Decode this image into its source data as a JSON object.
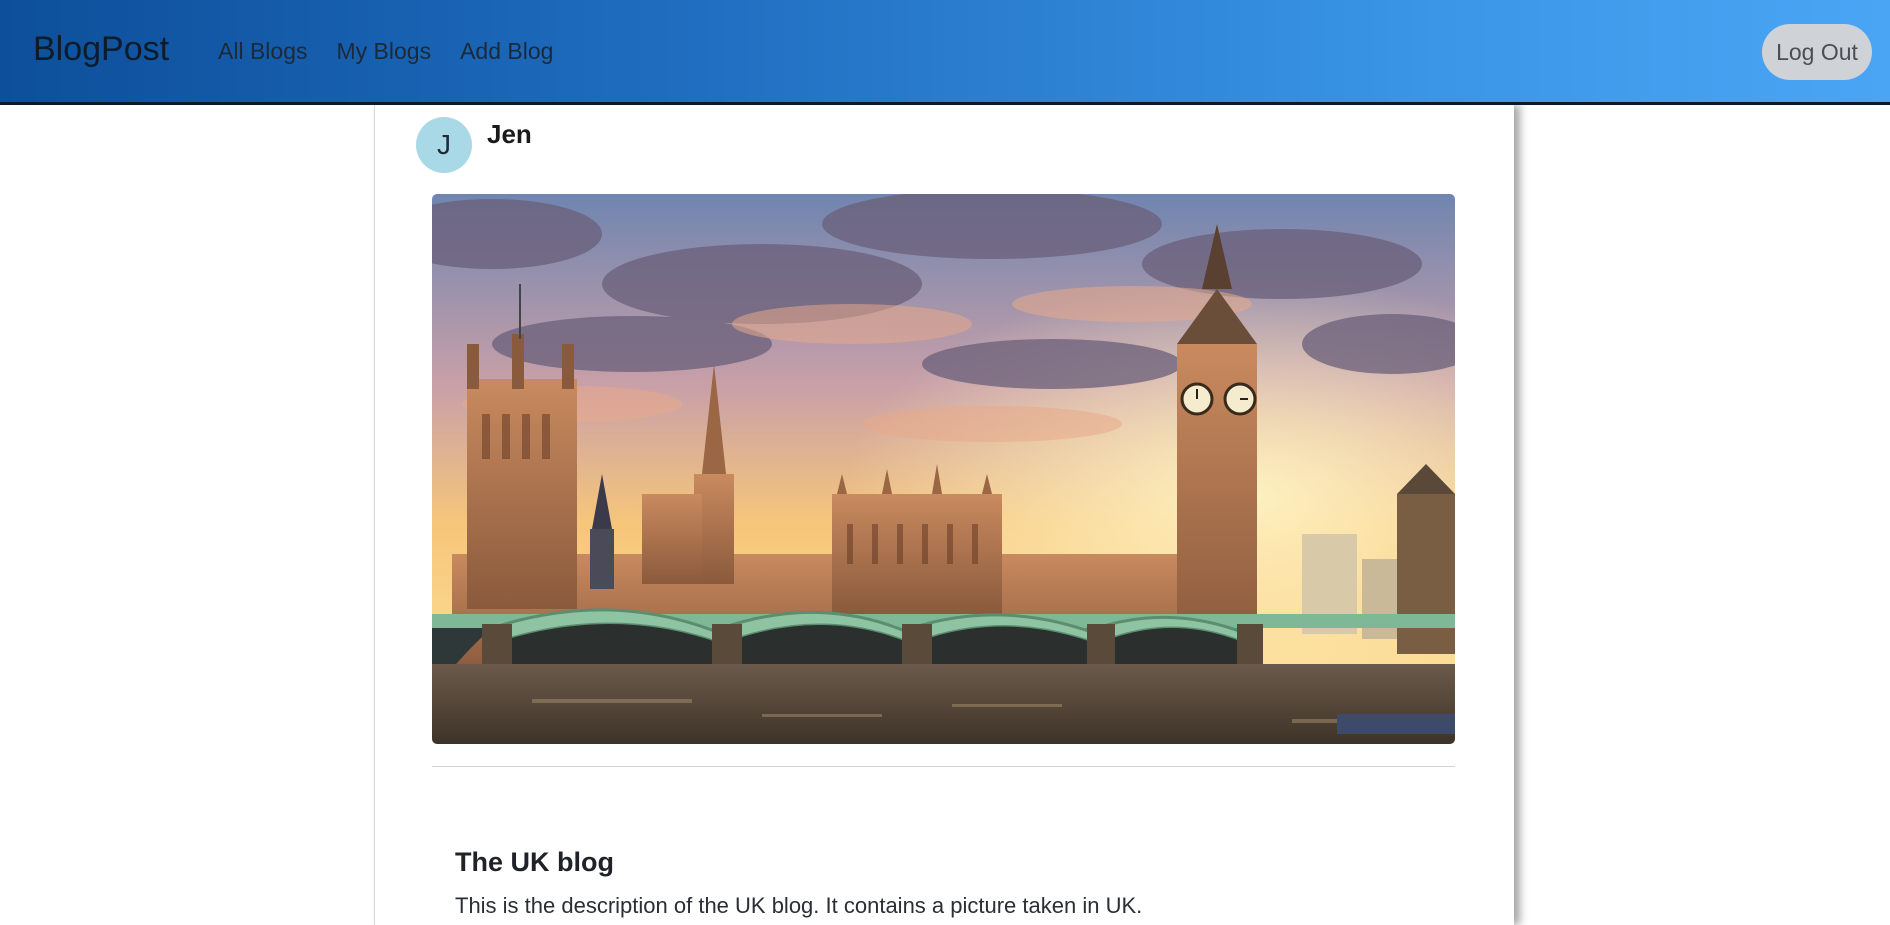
{
  "nav": {
    "brand": "BlogPost",
    "links": [
      "All Blogs",
      "My Blogs",
      "Add Blog"
    ],
    "logout_label": "Log Out"
  },
  "post": {
    "author_initial": "J",
    "author_name": "Jen",
    "image_alt": "Westminster Bridge and the Houses of Parliament with Big Ben at sunset",
    "title": "The UK blog",
    "description": "This is the description of the UK blog. It contains a picture taken in UK."
  },
  "colors": {
    "nav_gradient_start": "#0d4f9a",
    "nav_gradient_end": "#4aa6f5",
    "avatar_bg": "#a9d8e6",
    "logout_bg": "#cfd2d6"
  }
}
